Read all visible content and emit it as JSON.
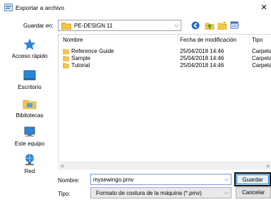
{
  "window": {
    "title": "Exportar a archivo",
    "close_glyph": "✕"
  },
  "lookin": {
    "label": "Guardar en:",
    "value": "PE-DESIGN 11",
    "chevron": "⌵"
  },
  "toolbar": {
    "icons": [
      "back-icon",
      "up-folder-icon",
      "new-folder-icon",
      "view-menu-icon"
    ]
  },
  "places": [
    {
      "label": "Acceso rápido",
      "icon": "star-icon"
    },
    {
      "label": "Escritorio",
      "icon": "desktop-icon"
    },
    {
      "label": "Bibliotecas",
      "icon": "libraries-icon"
    },
    {
      "label": "Este equipo",
      "icon": "computer-icon"
    },
    {
      "label": "Red",
      "icon": "network-icon"
    }
  ],
  "list": {
    "columns": [
      "Nombre",
      "Fecha de modificación",
      "Tipo"
    ],
    "rows": [
      {
        "name": "Reference Guide",
        "date": "25/04/2018 14:46",
        "type": "Carpeta d"
      },
      {
        "name": "Sample",
        "date": "25/04/2018 14:46",
        "type": "Carpeta d"
      },
      {
        "name": "Tutorial",
        "date": "25/04/2018 14:46",
        "type": "Carpeta d"
      }
    ]
  },
  "scroll": {
    "left": "<",
    "right": ">"
  },
  "filename": {
    "label": "Nombre:",
    "value": "mysewingo.pmv"
  },
  "filetype": {
    "label": "Tipo:",
    "value": "Formato de costura de la máquina (*.pmv)"
  },
  "buttons": {
    "save": "Guardar",
    "cancel": "Cancelar"
  },
  "colors": {
    "folder": "#f3c54a",
    "accent": "#0078d7",
    "star": "#2e82d9"
  }
}
